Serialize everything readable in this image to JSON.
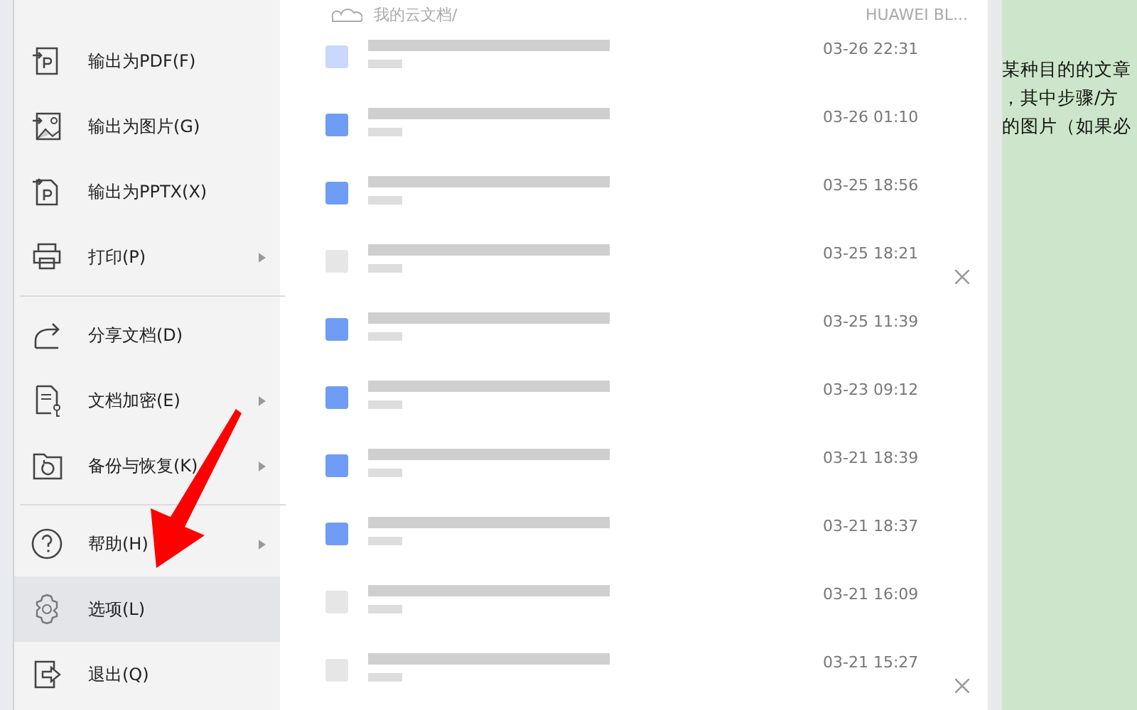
{
  "menu": {
    "items": [
      {
        "kind": "item",
        "label": "输出为PDF(F)",
        "submenu": false,
        "selected": false
      },
      {
        "kind": "item",
        "label": "输出为图片(G)",
        "submenu": false,
        "selected": false
      },
      {
        "kind": "item",
        "label": "输出为PPTX(X)",
        "submenu": false,
        "selected": false
      },
      {
        "kind": "item",
        "label": "打印(P)",
        "submenu": true,
        "selected": false
      },
      {
        "kind": "divider"
      },
      {
        "kind": "item",
        "label": "分享文档(D)",
        "submenu": false,
        "selected": false
      },
      {
        "kind": "item",
        "label": "文档加密(E)",
        "submenu": true,
        "selected": false
      },
      {
        "kind": "item",
        "label": "备份与恢复(K)",
        "submenu": true,
        "selected": false
      },
      {
        "kind": "divider"
      },
      {
        "kind": "item",
        "label": "帮助(H)",
        "submenu": true,
        "selected": false
      },
      {
        "kind": "item",
        "label": "选项(L)",
        "submenu": false,
        "selected": true
      },
      {
        "kind": "item",
        "label": "退出(Q)",
        "submenu": false,
        "selected": false
      }
    ]
  },
  "files": {
    "path": "我的云文档/",
    "device": "HUAWEI BL...",
    "rows": [
      {
        "color": "#c9d8fb",
        "time": "03-26 22:31",
        "closable": false
      },
      {
        "color": "#6f9cf5",
        "time": "03-26 01:10",
        "closable": false
      },
      {
        "color": "#6f9cf5",
        "time": "03-25 18:56",
        "closable": false
      },
      {
        "color": "#e6e6e6",
        "time": "03-25 18:21",
        "closable": true
      },
      {
        "color": "#6f9cf5",
        "time": "03-25 11:39",
        "closable": false
      },
      {
        "color": "#6f9cf5",
        "time": "03-23 09:12",
        "closable": false
      },
      {
        "color": "#6f9cf5",
        "time": "03-21 18:39",
        "closable": false
      },
      {
        "color": "#6f9cf5",
        "time": "03-21 18:37",
        "closable": false
      },
      {
        "color": "#e6e6e6",
        "time": "03-21 16:09",
        "closable": false
      },
      {
        "color": "#e6e6e6",
        "time": "03-21 15:27",
        "closable": true
      }
    ]
  },
  "document": {
    "lines": [
      "某种目的的文章",
      "，其中步骤/方",
      "的图片（如果必"
    ]
  }
}
